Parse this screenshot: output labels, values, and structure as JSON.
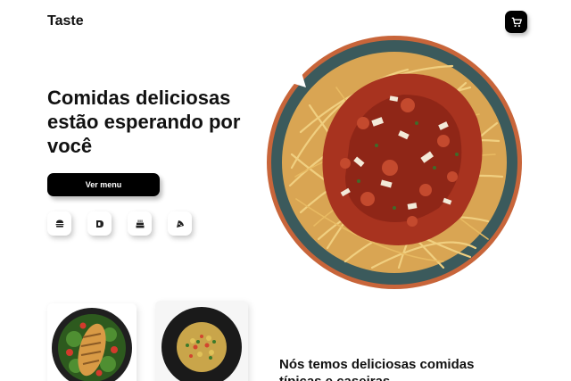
{
  "header": {
    "brand": "Taste",
    "cart_icon": "cart-icon"
  },
  "hero": {
    "title": "Comidas deliciosas estão esperando por você",
    "cta_label": "Ver menu",
    "category_icons": [
      "burger-icon",
      "sandwich-icon",
      "cake-icon",
      "pizza-icon"
    ],
    "image": "spaghetti-bolognese-plate"
  },
  "dishes": [
    {
      "image": "grilled-chicken-salad-plate"
    },
    {
      "image": "fried-rice-vegetables-plate"
    }
  ],
  "section": {
    "title": "Nós temos deliciosas comidas típicas e caseiras"
  },
  "colors": {
    "primary": "#000000",
    "background": "#ffffff"
  }
}
